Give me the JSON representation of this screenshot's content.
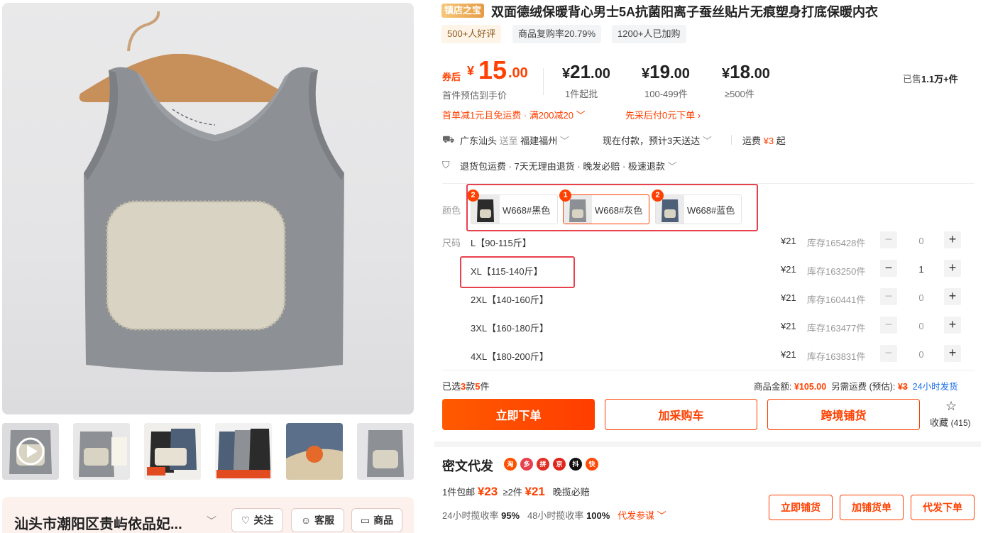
{
  "product": {
    "shop_tag": "镇店之宝",
    "title": "双面德绒保暖背心男士5A抗菌阳离子蚕丝贴片无痕塑身打底保暖内衣",
    "pills": [
      "500+人好评",
      "商品复购率20.79%",
      "1200+人已加购"
    ]
  },
  "pricing": {
    "coupon_label": "券后",
    "currency": "¥",
    "coupon_int": "15",
    "coupon_dec": ".00",
    "coupon_note": "首件预估到手价",
    "tiers": [
      {
        "int": "21",
        "dec": ".00",
        "label": "1件起批"
      },
      {
        "int": "19",
        "dec": ".00",
        "label": "100-499件"
      },
      {
        "int": "18",
        "dec": ".00",
        "label": "≥500件"
      }
    ],
    "sold_prefix": "已售",
    "sold_value": "1.1万+",
    "sold_suffix": "件",
    "promo1": "首单减1元且免运费 · 满200减20",
    "promo2": "先采后付0元下单"
  },
  "shipping": {
    "origin": "广东汕头",
    "send_to_label": "送至",
    "dest": "福建福州",
    "delivery": "现在付款，预计3天送达",
    "fee_label": "运费",
    "fee_value": "¥3",
    "fee_suffix": "起"
  },
  "services": {
    "text": "退货包运费 · 7天无理由退货 · 晚发必赔 · 极速退款"
  },
  "color": {
    "label": "颜色",
    "options": [
      {
        "badge": "2",
        "name": "W668#黑色",
        "swatch": "#2b2b2b"
      },
      {
        "badge": "1",
        "name": "W668#灰色",
        "swatch": "#8c8f93"
      },
      {
        "badge": "2",
        "name": "W668#蓝色",
        "swatch": "#4e6078"
      }
    ]
  },
  "size": {
    "label": "尺码",
    "rows": [
      {
        "name": "L【90-115斤】",
        "price": "¥21",
        "stock": "库存165428件",
        "qty": "0"
      },
      {
        "name": "XL【115-140斤】",
        "price": "¥21",
        "stock": "库存163250件",
        "qty": "1"
      },
      {
        "name": "2XL【140-160斤】",
        "price": "¥21",
        "stock": "库存160441件",
        "qty": "0"
      },
      {
        "name": "3XL【160-180斤】",
        "price": "¥21",
        "stock": "库存163477件",
        "qty": "0"
      },
      {
        "name": "4XL【180-200斤】",
        "price": "¥21",
        "stock": "库存163831件",
        "qty": "0"
      }
    ],
    "minus": "−",
    "plus": "+"
  },
  "summary": {
    "selected_prefix": "已选",
    "styles": "3",
    "styles_unit": "款",
    "pieces": "5",
    "pieces_unit": "件",
    "amount_label": "商品金额:",
    "amount": "¥105.00",
    "fee_label": "另需运费 (预估):",
    "fee": "¥3",
    "ship_note": "24小时发货"
  },
  "actions": {
    "buy": "立即下单",
    "cart": "加采购车",
    "cross": "跨境铺货",
    "fav": "收藏",
    "fav_count": "(415)"
  },
  "dropship": {
    "title": "密文代发",
    "channels": [
      "淘",
      "多",
      "拼",
      "京",
      "抖",
      "快"
    ],
    "one_label": "1件包邮",
    "one_price": "¥23",
    "two_label": "≥2件",
    "two_price": "¥21",
    "late_note": "晚揽必赔",
    "rate24_label": "24小时揽收率",
    "rate24": "95%",
    "rate48_label": "48小时揽收率",
    "rate48": "100%",
    "ref_label": "代发参谋",
    "btn1": "立即铺货",
    "btn2": "加铺货单",
    "btn3": "代发下单"
  },
  "shop": {
    "name": "汕头市潮阳区贵屿依品妃...",
    "follow": "关注",
    "service": "客服",
    "goods": "商品"
  },
  "colors": {
    "accent": "#ff4000",
    "highlight_box": "#e8414e"
  }
}
